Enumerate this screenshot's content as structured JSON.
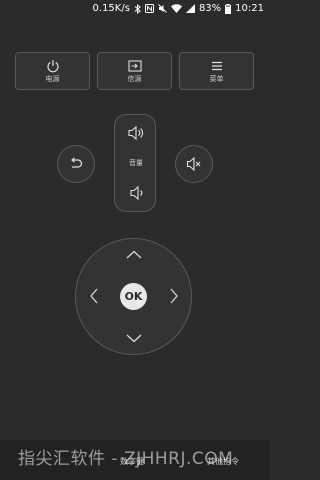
{
  "status_bar": {
    "speed": "0.15K/s",
    "battery": "83%",
    "time": "10:21",
    "icons": [
      "bluetooth-icon",
      "nfc-icon",
      "mute-icon",
      "wifi-icon",
      "signal-icon",
      "battery-icon"
    ]
  },
  "top_buttons": [
    {
      "label": "电源",
      "icon": "power-icon"
    },
    {
      "label": "信源",
      "icon": "input-source-icon"
    },
    {
      "label": "菜单",
      "icon": "menu-icon"
    }
  ],
  "side_buttons": {
    "back_icon": "back-icon",
    "mute_icon": "mute-icon"
  },
  "volume": {
    "label": "音量",
    "up_icon": "volume-up-icon",
    "down_icon": "volume-down-icon"
  },
  "dpad": {
    "ok_label": "OK",
    "icons": [
      "arrow-up-icon",
      "arrow-down-icon",
      "arrow-left-icon",
      "arrow-right-icon"
    ]
  },
  "bottom_bar": {
    "items": [
      "数字键",
      "其他指令"
    ]
  },
  "watermark": "指尖汇软件 - ZJHHRJ.COM",
  "colors": {
    "background": "#2b2b2b",
    "button_bg": "#333333",
    "border": "#5a5a5a",
    "ok_button": "#e8e8e8"
  }
}
